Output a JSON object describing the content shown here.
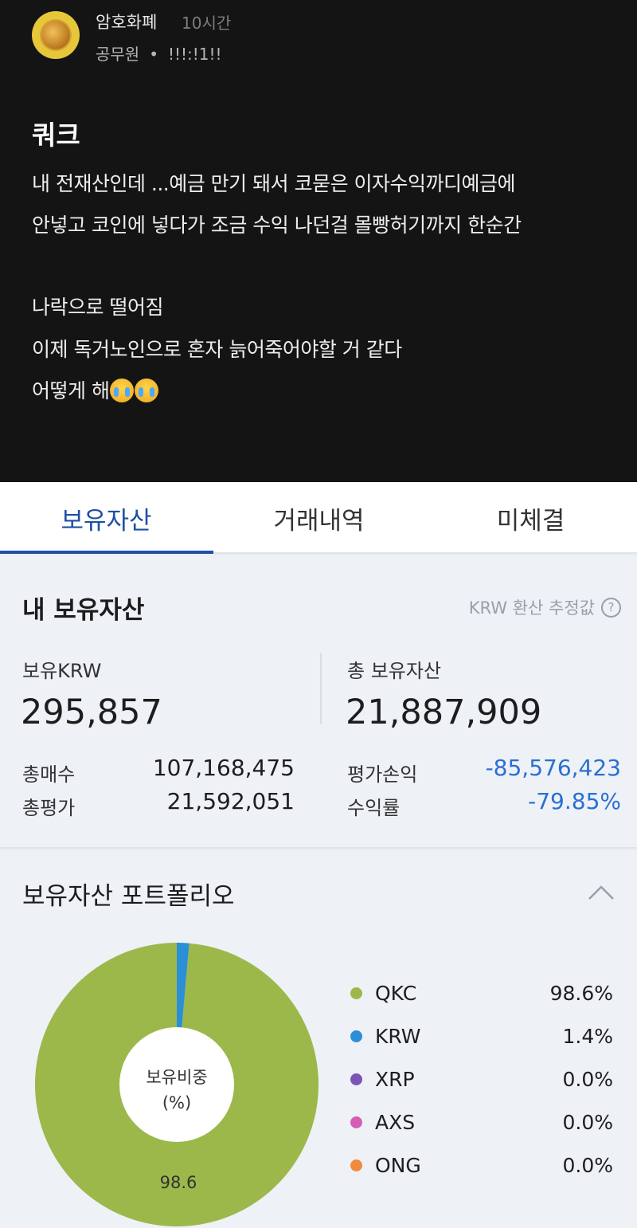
{
  "post": {
    "board": "암호화폐",
    "time": "10시간",
    "author": "공무원",
    "separator": "•",
    "nickname": "!!!:!1!!",
    "title": "쿼크",
    "lines": [
      "내 전재산인데 ...예금 만기 돼서 코묻은 이자수익까디예금에",
      "안넣고 코인에 넣다가 조금 수익 나던걸 몰빵허기까지 한순간",
      "나락으로 떨어짐",
      "이제 독거노인으로 혼자 늙어죽어야할 거 같다",
      "어떻게 해"
    ],
    "emoji": "crying-face-icon"
  },
  "tabs": [
    {
      "label": "보유자산",
      "active": true
    },
    {
      "label": "거래내역",
      "active": false
    },
    {
      "label": "미체결",
      "active": false
    }
  ],
  "summary": {
    "title": "내 보유자산",
    "krw_note": "KRW 환산 추정값",
    "help_icon": "?",
    "krw_label": "보유KRW",
    "krw_value": "295,857",
    "total_label": "총 보유자산",
    "total_value": "21,887,909",
    "buy_label": "총매수",
    "buy_value": "107,168,475",
    "eval_label": "총평가",
    "eval_value": "21,592,051",
    "pl_label": "평가손익",
    "pl_value": "-85,576,423",
    "rate_label": "수익률",
    "rate_value": "-79.85%",
    "negative_color": "#2a6fd1"
  },
  "portfolio": {
    "title": "보유자산 포트폴리오",
    "collapse_icon": "chevron-up-icon",
    "center_label_1": "보유비중",
    "center_label_2": "(%)",
    "slice_label": "98.6"
  },
  "chart_data": {
    "type": "pie",
    "categories": [
      "QKC",
      "KRW",
      "XRP",
      "AXS",
      "ONG"
    ],
    "values": [
      98.6,
      1.4,
      0.0,
      0.0,
      0.0
    ],
    "display": [
      "98.6%",
      "1.4%",
      "0.0%",
      "0.0%",
      "0.0%"
    ],
    "colors": [
      "#9cb84a",
      "#2b8fd6",
      "#7b55b5",
      "#d55db6",
      "#f08a3c"
    ],
    "donut": true
  }
}
